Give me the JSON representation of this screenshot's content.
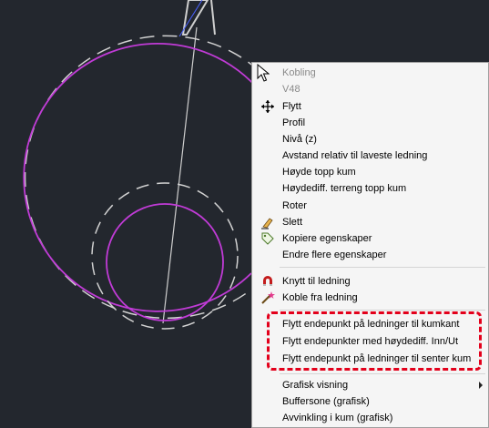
{
  "colors": {
    "canvas_bg": "#23272e",
    "circle_magenta": "#c03bd6",
    "circle_dashed": "#d2d2d2",
    "pipe_line": "#cfcfcf",
    "pipe_blue": "#4a62ff",
    "highlight": "#e3001b",
    "menu_bg": "#f5f5f5"
  },
  "context_menu": {
    "items": [
      {
        "label": "Kobling",
        "disabled": true,
        "icon": "cursor-icon"
      },
      {
        "label": "V48",
        "disabled": true
      },
      {
        "label": "Flytt",
        "icon": "move-arrows-icon"
      },
      {
        "label": "Profil"
      },
      {
        "label": "Nivå (z)"
      },
      {
        "label": "Avstand relativ til laveste ledning"
      },
      {
        "label": "Høyde topp kum"
      },
      {
        "label": "Høydediff. terreng topp kum"
      },
      {
        "label": "Roter"
      },
      {
        "label": "Slett",
        "icon": "eraser-icon"
      },
      {
        "label": "Kopiere egenskaper",
        "icon": "tag-icon"
      },
      {
        "label": "Endre flere egenskaper"
      },
      {
        "label": "Knytt til ledning",
        "icon": "magnet-icon"
      },
      {
        "label": "Koble fra ledning",
        "icon": "wand-icon"
      },
      {
        "label": "Flytt endepunkt på ledninger til kumkant"
      },
      {
        "label": "Flytt endepunkter med høydediff. Inn/Ut"
      },
      {
        "label": "Flytt endepunkt på ledninger til senter kum"
      },
      {
        "label": "Grafisk visning",
        "submenu": true
      },
      {
        "label": "Buffersone (grafisk)"
      },
      {
        "label": "Avvinkling i kum (grafisk)"
      }
    ]
  }
}
